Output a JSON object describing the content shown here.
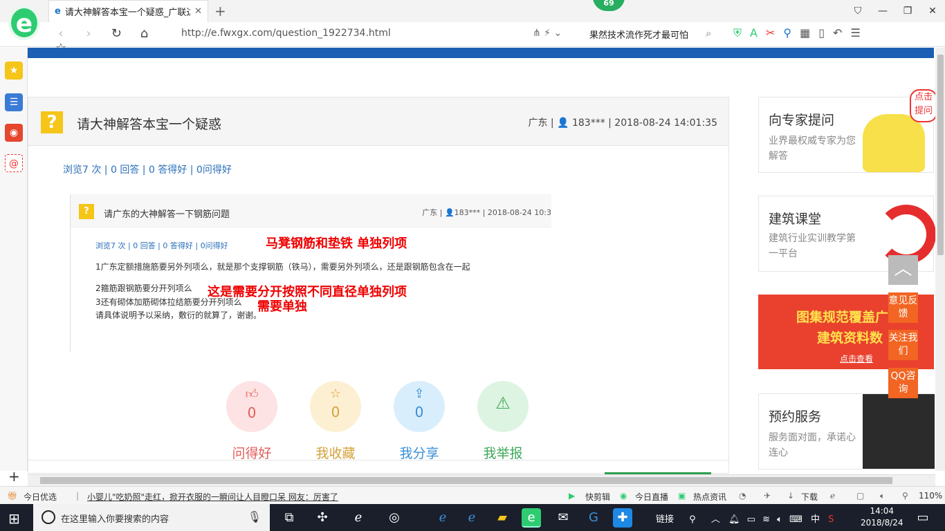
{
  "browser": {
    "tab_title": "请大神解答本宝一个疑惑_广联达",
    "badge_count": "69",
    "url": "http://e.fwxgx.com/question_1922734.html",
    "search_text": "果然技术流作死才最可怕",
    "colors": {
      "accent": "#2ecc71",
      "site_blue": "#1a5fb4"
    }
  },
  "question": {
    "icon_char": "?",
    "title": "请大神解答本宝一个疑惑",
    "meta": "广东 | 👤 183*** | 2018-08-24 14:01:35",
    "stats": "浏览7 次 | 0 回答 | 0 答得好 | 0问得好"
  },
  "embedded_screenshot": {
    "title": "请广东的大神解答一下钢筋问题",
    "meta": "广东 | 👤183*** | 2018-08-24 10:3",
    "stats": "浏览7 次 | 0 回答 | 0 答得好 | 0问得好",
    "lines": [
      "1广东定额措施筋要另外列项么，就是那个支撑钢筋（铁马），需要另外列项么，还是跟钢筋包含在一起",
      "2箍筋跟钢筋要分开列项么",
      "3还有砌体加筋砌体拉结筋要分开列项么",
      "请具体说明予以采纳，敷衍的就算了，谢谢。"
    ],
    "annotations": [
      "马凳钢筋和垫铁 单独列项",
      "这是需要分开按照不同直径单独列项",
      "需要单独"
    ]
  },
  "actions": [
    {
      "label": "问得好",
      "count": "0",
      "icon": "thumbs-up-icon"
    },
    {
      "label": "我收藏",
      "count": "0",
      "icon": "star-icon"
    },
    {
      "label": "我分享",
      "count": "0",
      "icon": "share-icon"
    },
    {
      "label": "我举报",
      "count": "",
      "icon": "warning-icon"
    }
  ],
  "sidebar_cards": [
    {
      "title": "向专家提问",
      "sub": "业界最权威专家为您解答",
      "bubble": "点击提问"
    },
    {
      "title": "建筑课堂",
      "sub": "建筑行业实训教学第一平台"
    },
    {
      "title": "预约服务",
      "sub": "服务面对面，承诺心连心"
    }
  ],
  "banner": {
    "line1": "图集规范覆盖广",
    "line2": "建筑资料数",
    "link": "点击查看"
  },
  "float_buttons": [
    "意见反馈",
    "关注我们",
    "QQ咨询"
  ],
  "statusbar": {
    "left_label": "今日优选",
    "news": "小婴儿\"吃奶照\"走红，掀开衣服的一瞬间让人目瞪口呆 网友：厉害了",
    "items": [
      "快剪辑",
      "今日直播",
      "热点资讯",
      "下载"
    ],
    "zoom": "110%"
  },
  "taskbar": {
    "search_placeholder": "在这里输入你要搜索的内容",
    "tray_link": "链接",
    "ime": "中",
    "time": "14:04",
    "date": "2018/8/24"
  }
}
